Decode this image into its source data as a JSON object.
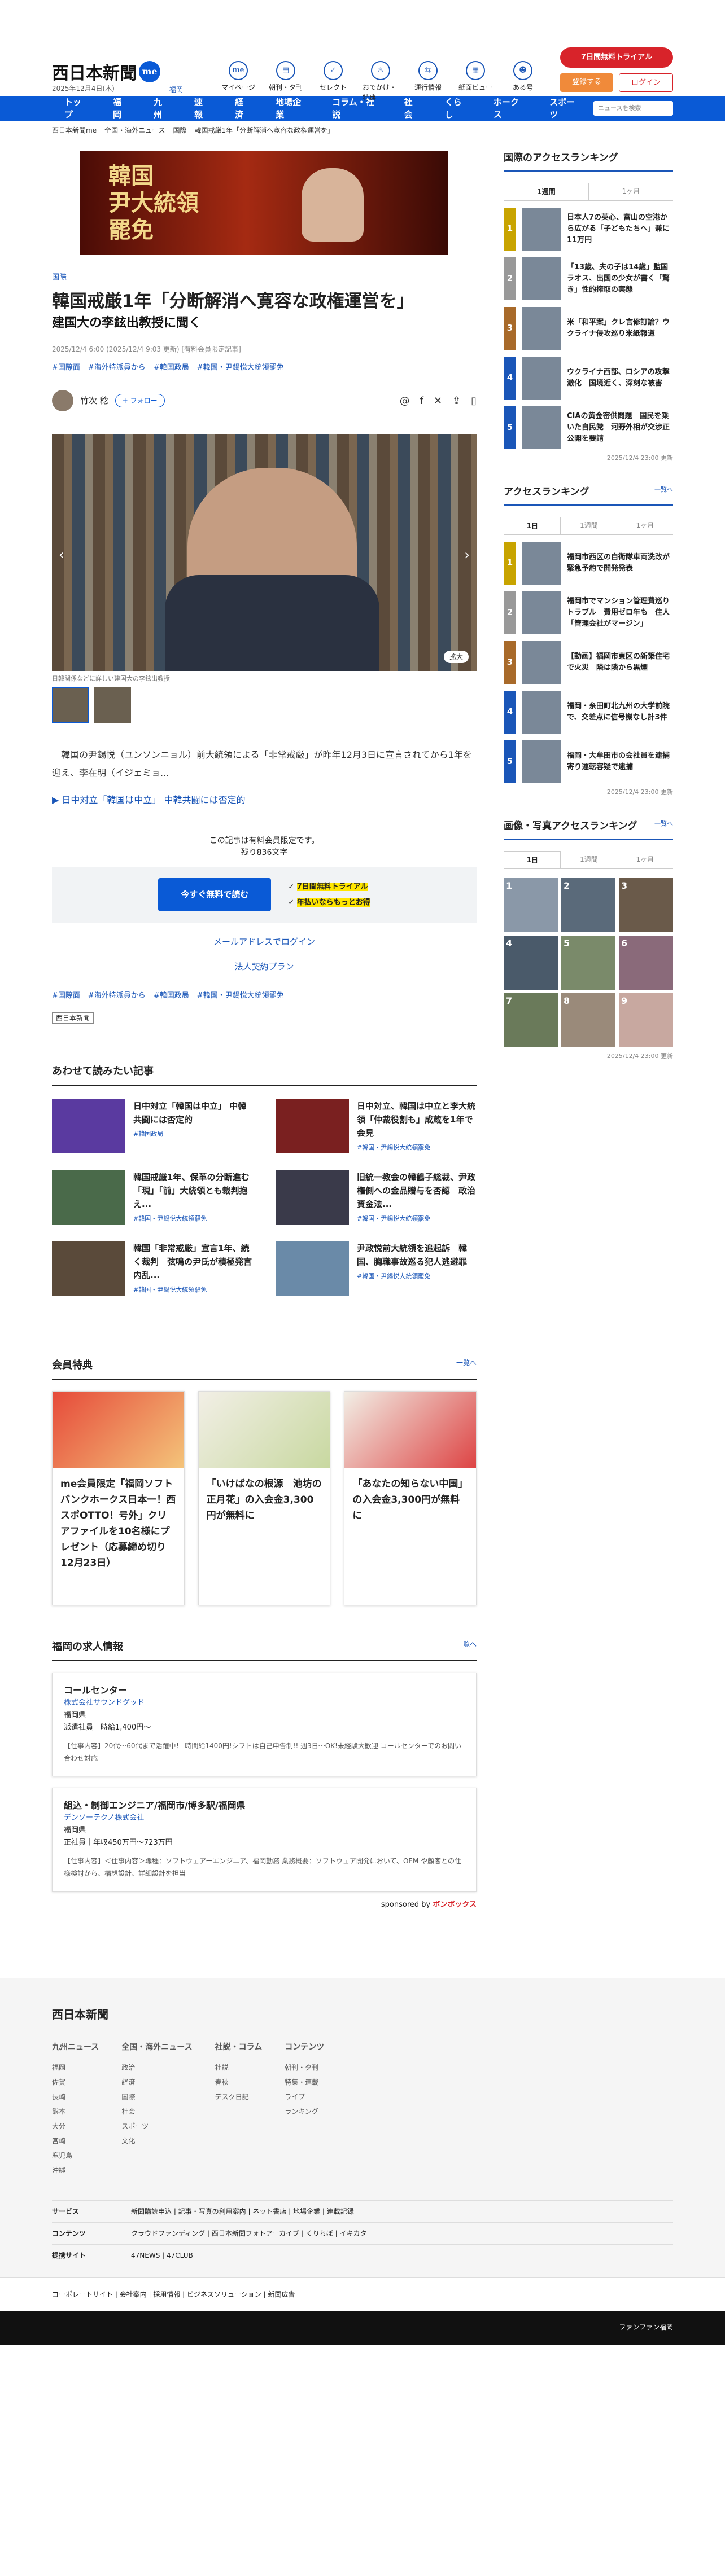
{
  "header": {
    "logo": "西日本新聞",
    "logo_badge": "me",
    "date": "2025年12月4日(木)",
    "location": "福岡",
    "nav": [
      {
        "icon": "me-icon",
        "label": "マイページ"
      },
      {
        "icon": "newspaper-icon",
        "label": "朝刊・夕刊"
      },
      {
        "icon": "select-icon",
        "label": "セレクト"
      },
      {
        "icon": "coupon-icon",
        "label": "おでかけ・特典"
      },
      {
        "icon": "ticket-icon",
        "label": "運行情報"
      },
      {
        "icon": "board-icon",
        "label": "紙面ビュー"
      },
      {
        "icon": "mascot-icon",
        "label": "ある号"
      }
    ],
    "trial": "7日間無料トライアル",
    "register": "登録する",
    "login": "ログイン"
  },
  "gnav": [
    "トップ",
    "福岡",
    "九州",
    "速報",
    "経済",
    "地場企業",
    "コラム・社説",
    "社会",
    "くらし",
    "ホークス",
    "スポーツ"
  ],
  "search_placeholder": "ニュースを検索",
  "breadcrumb": [
    "西日本新聞me",
    "全国・海外ニュース",
    "国際",
    "韓国戒厳1年「分断解消へ寛容な政権運営を」"
  ],
  "banner": "韓国\n尹大統領\n罷免",
  "article": {
    "category": "国際",
    "title": "韓国戒厳1年「分断解消へ寛容な政権運営を」",
    "subtitle": "建国大の李鉉出教授に聞く",
    "meta": "2025/12/4 6:00 (2025/12/4 9:03 更新) [有料会員限定記事]",
    "tags": [
      "#国際面",
      "#海外特派員から",
      "#韓国政局",
      "#韓国・尹錫悦大統領罷免"
    ],
    "author": "竹次 稔",
    "follow": "+ フォロー",
    "caption": "日韓関係などに詳しい建国大の李鉉出教授",
    "zoom": "拡大",
    "lead": "　韓国の尹錫悦（ユンソンニョル）前大統領による「非常戒厳」が昨年12月3日に宣言されてから1年を迎え、李在明（イジェミョ...",
    "related": "日中対立「韓国は中立」 中韓共闘には否定的",
    "premium_note": "この記事は有料会員限定です。",
    "remaining": "残り836文字",
    "cta": "今すぐ無料で読む",
    "perk1": "7日間無料トライアル",
    "perk2": "年払いならもっとお得",
    "link1": "メールアドレスでログイン",
    "link2": "法人契約プラン",
    "tags2": [
      "#国際面",
      "#海外特派員から",
      "#韓国政局",
      "#韓国・尹錫悦大統領罷免"
    ],
    "publisher": "西日本新聞"
  },
  "related_section": {
    "title": "あわせて読みたい記事",
    "items": [
      {
        "title": "日中対立「韓国は中立」 中韓共闘には否定的",
        "tag": "#韓国政局"
      },
      {
        "title": "日中対立、韓国は中立と李大統領「仲裁役割も」成蔵を1年で会見",
        "tag": "#韓国・尹錫悦大統領罷免"
      },
      {
        "title": "韓国戒厳1年、保革の分断進む「現」「前」大統領とも裁判抱え...",
        "tag": "#韓国・尹錫悦大統領罷免"
      },
      {
        "title": "旧統一教会の韓鶴子総裁、尹政権側への金品贈与を否認　政治資金法...",
        "tag": "#韓国・尹錫悦大統領罷免"
      },
      {
        "title": "韓国「非常戒厳」宣言1年、続く裁判　弦鳴の尹氏が積極発言　内乱...",
        "tag": "#韓国・尹錫悦大統領罷免"
      },
      {
        "title": "尹政悦前大統領を追起訴　韓国、胸職事故巡る犯人逃避罪",
        "tag": "#韓国・尹錫悦大統領罷免"
      }
    ]
  },
  "benefits": {
    "title": "会員特典",
    "more": "一覧へ",
    "items": [
      "me会員限定「福岡ソフトバンクホークス日本一！西スポOTTO！号外」クリアファイルを10名様にプレゼント（応募締め切り12月23日）",
      "「いけばなの根源　池坊の正月花」の入会金3,300円が無料に",
      "「あなたの知らない中国」の入会金3,300円が無料に"
    ]
  },
  "jobs": {
    "title": "福岡の求人情報",
    "more": "一覧へ",
    "items": [
      {
        "title": "コールセンター",
        "company": "株式会社サウンドグッド",
        "place": "福岡県",
        "pay": "派遣社員｜時給1,400円〜",
        "desc": "【仕事内容】20代〜60代まで活躍中！ 時間給1400円!シフトは自己申告制!! 週3日〜OK!未経験大歓迎 コールセンターでのお問い合わせ対応"
      },
      {
        "title": "組込・制御エンジニア/福岡市/博多駅/福岡県",
        "company": "デンソーテクノ株式会社",
        "place": "福岡県",
        "pay": "正社員｜年収450万円〜723万円",
        "desc": "【仕事内容】＜仕事内容＞職種：ソフトウェアーエンジニア、福岡勤務 業務概要：ソフトウェア開発において、OEM や顧客との仕様検討から、構想設計、詳細設計を担当"
      }
    ],
    "sponsored": "sponsored by",
    "sponsor": "ボンボックス"
  },
  "sidebar": {
    "intl_ranking": {
      "title": "国際のアクセスランキング",
      "tabs": [
        "1週間",
        "1ヶ月"
      ],
      "items": [
        "日本人7の英心、富山の空港から広がる「子どもたちへ」兼に11万円",
        "「13歳、夫の子は14歳」監国ラオス、出国の少女が書く「驚き」性的搾取の実態",
        "米「和平案」クレ言修訂論？ウクライナ侵攻巡り米紙報道",
        "ウクライナ西部、ロシアの攻撃激化　国境近く、深刻な被害",
        "CIAの黄金密供問題　国民を乗いた自民党　河野外相が交渉正公開を要請"
      ],
      "updated": "2025/12/4 23:00 更新"
    },
    "access_ranking": {
      "title": "アクセスランキング",
      "more": "一覧へ",
      "tabs": [
        "1日",
        "1週間",
        "1ヶ月"
      ],
      "items": [
        "福岡市西区の自衛隊車両洗改が緊急予約で開発発表",
        "福岡市でマンション管理費巡りトラブル　費用ゼロ年も　住人「管理会社がマージン」",
        "【動画】福岡市東区の新築住宅で火災　隣は隣から黒煙",
        "福岡・糸田町北九州の大学前院で、交差点に信号機なし計3件",
        "福岡・大牟田市の会社員を逮捕 寄り運転容疑で逮捕"
      ],
      "updated": "2025/12/4 23:00 更新"
    },
    "photo_ranking": {
      "title": "画像・写真アクセスランキング",
      "more": "一覧へ",
      "tabs": [
        "1日",
        "1週間",
        "1ヶ月"
      ],
      "nums": [
        "1",
        "2",
        "3",
        "4",
        "5",
        "6",
        "7",
        "8",
        "9"
      ],
      "updated": "2025/12/4 23:00 更新"
    }
  },
  "footer": {
    "logo": "西日本新聞",
    "cols": [
      {
        "h": "九州ニュース",
        "items": [
          "福岡",
          "佐賀",
          "長崎",
          "熊本",
          "大分",
          "宮崎",
          "鹿児島",
          "沖縄"
        ]
      },
      {
        "h": "全国・海外ニュース",
        "items": [
          "政治",
          "経済",
          "国際",
          "社会",
          "スポーツ",
          "文化"
        ]
      },
      {
        "h": "社説・コラム",
        "items": [
          "社説",
          "春秋",
          "デスク日記"
        ]
      },
      {
        "h": "コンテンツ",
        "items": [
          "朝刊・夕刊",
          "特集・連載",
          "ライブ",
          "ランキング"
        ]
      }
    ],
    "service_h": "サービス",
    "service": "新聞購読申込 | 記事・写真の利用案内 | ネット書店 | 地場企業 | 連載記録",
    "content_h": "コンテンツ",
    "content": "クラウドファンディング | 西日本新聞フォトアーカイブ | くりらぼ | イキカタ",
    "partner_h": "提携サイト",
    "partner": "47NEWS | 47CLUB",
    "corp": "コーポレートサイト | 会社案内 | 採用情報 | ビジネスソリューション | 新聞広告",
    "bottom": "ファンファン福岡"
  }
}
